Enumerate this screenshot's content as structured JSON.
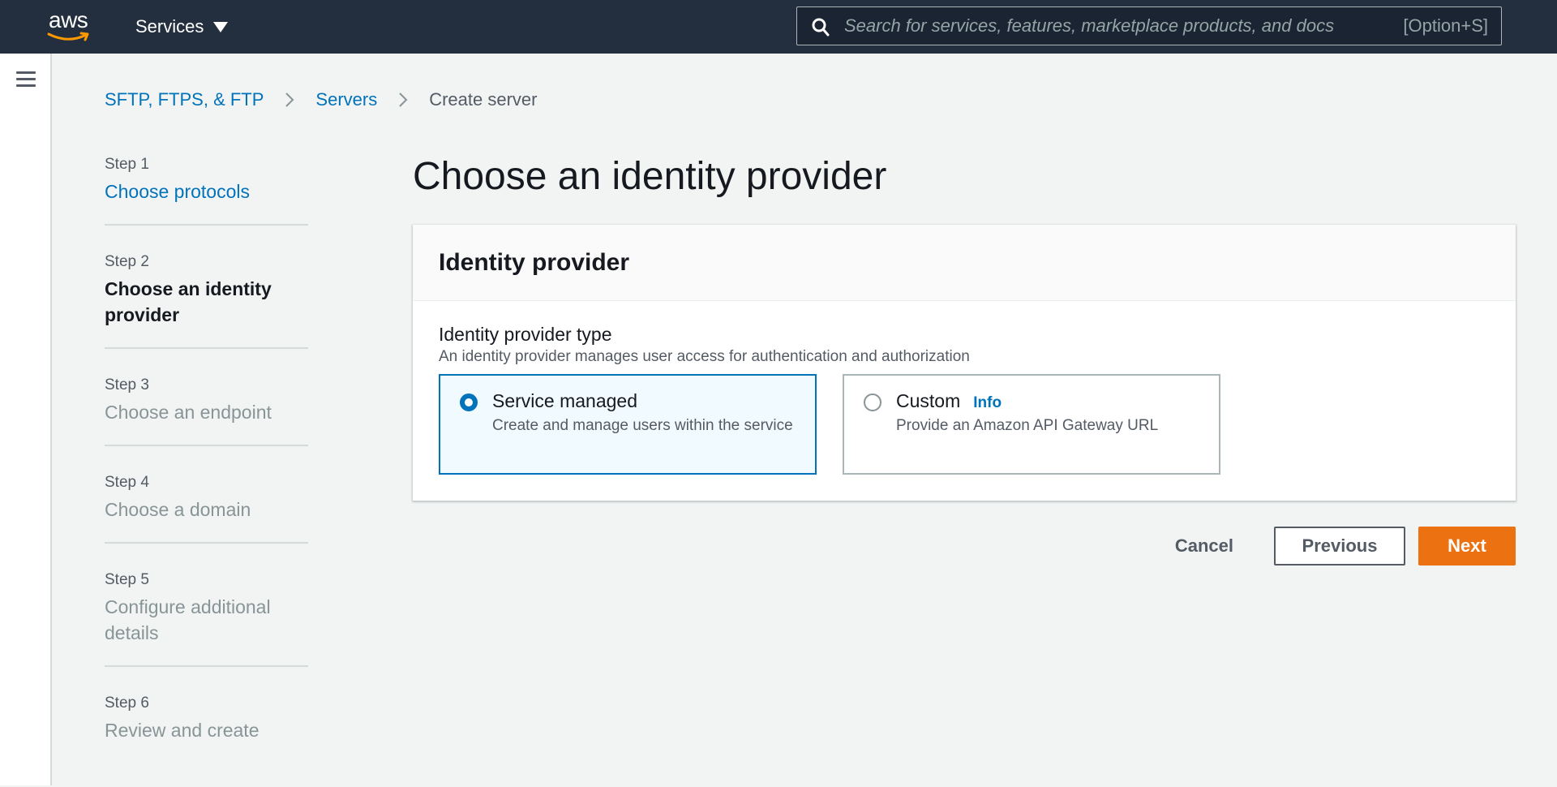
{
  "topbar": {
    "logo_text": "aws",
    "services_label": "Services",
    "search_placeholder": "Search for services, features, marketplace products, and docs",
    "search_shortcut": "[Option+S]"
  },
  "breadcrumb": {
    "items": [
      "SFTP, FTPS, & FTP",
      "Servers"
    ],
    "current": "Create server"
  },
  "steps": [
    {
      "num": "Step 1",
      "label": "Choose protocols"
    },
    {
      "num": "Step 2",
      "label": "Choose an identity provider"
    },
    {
      "num": "Step 3",
      "label": "Choose an endpoint"
    },
    {
      "num": "Step 4",
      "label": "Choose a domain"
    },
    {
      "num": "Step 5",
      "label": "Configure additional details"
    },
    {
      "num": "Step 6",
      "label": "Review and create"
    }
  ],
  "page": {
    "title": "Choose an identity provider"
  },
  "panel": {
    "header": "Identity provider",
    "field_label": "Identity provider type",
    "field_desc": "An identity provider manages user access for authentication and authorization",
    "options": [
      {
        "title": "Service managed",
        "desc": "Create and manage users within the service",
        "selected": true
      },
      {
        "title": "Custom",
        "info": "Info",
        "desc": "Provide an Amazon API Gateway URL",
        "selected": false
      }
    ]
  },
  "actions": {
    "cancel": "Cancel",
    "previous": "Previous",
    "next": "Next"
  },
  "colors": {
    "nav_bg": "#232f3e",
    "link": "#0073bb",
    "primary_button": "#ec7211",
    "aws_smile": "#ff9900"
  }
}
